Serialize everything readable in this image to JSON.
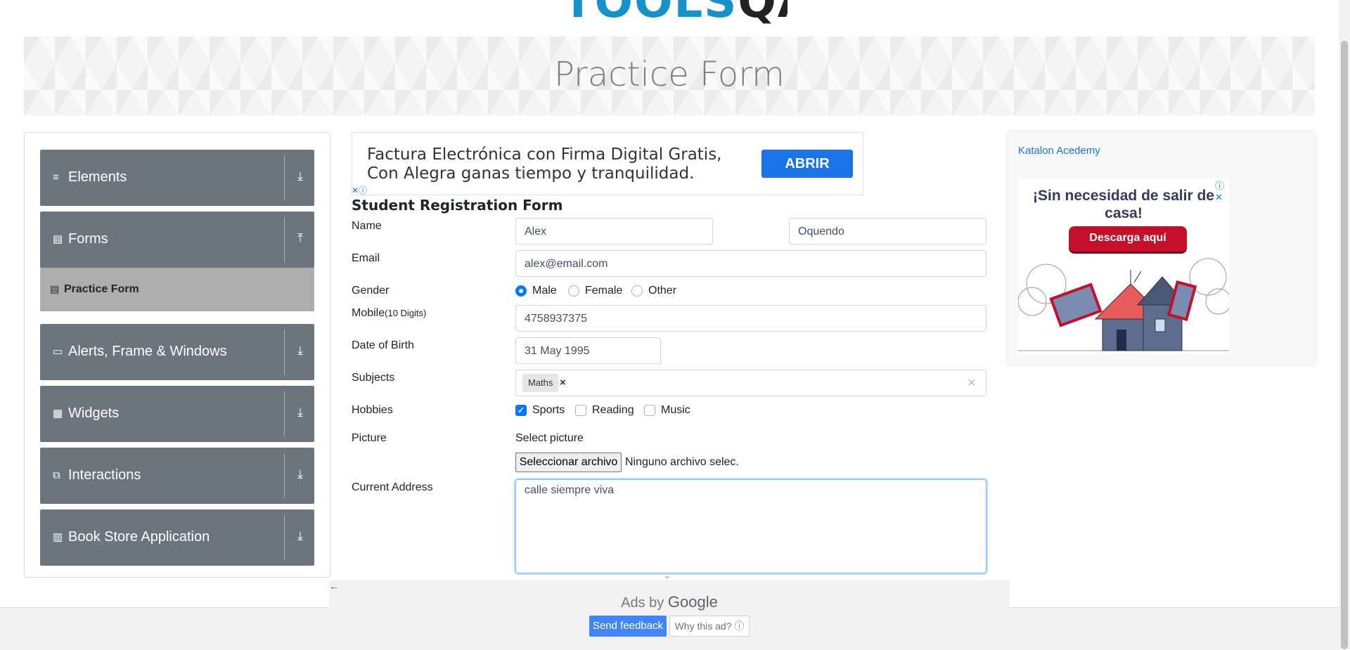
{
  "logo": {
    "text_part1": "TOOLS",
    "text_part2": "QA"
  },
  "banner": {
    "title": "Practice Form"
  },
  "sidebar": {
    "groups": [
      {
        "label": "Elements",
        "icon": "≡"
      },
      {
        "label": "Forms",
        "icon": "▤"
      },
      {
        "label": "Alerts, Frame & Windows",
        "icon": "▭"
      },
      {
        "label": "Widgets",
        "icon": "▦"
      },
      {
        "label": "Interactions",
        "icon": "⧉"
      },
      {
        "label": "Book Store Application",
        "icon": "▥"
      }
    ],
    "active_item": {
      "label": "Practice Form",
      "icon": "▤"
    }
  },
  "top_ad": {
    "line1": "Factura Electrónica con Firma Digital Gratis,",
    "line2": "Con Alegra ganas tiempo y tranquilidad.",
    "button": "ABRIR",
    "choices": "✕ⓘ"
  },
  "form": {
    "title": "Student Registration Form",
    "labels": {
      "name": "Name",
      "email": "Email",
      "gender": "Gender",
      "mobile": "Mobile",
      "mobile_hint": "(10 Digits)",
      "dob": "Date of Birth",
      "subjects": "Subjects",
      "hobbies": "Hobbies",
      "picture": "Picture",
      "address": "Current Address"
    },
    "values": {
      "first_name": "Alex",
      "last_name": "Oquendo",
      "email": "alex@email.com",
      "mobile": "4758937375",
      "dob": "31 May 1995",
      "address": "calle siempre viva"
    },
    "gender_options": [
      "Male",
      "Female",
      "Other"
    ],
    "gender_selected": "Male",
    "subjects": {
      "chip": "Maths",
      "chip_remove": "×",
      "clear": "×"
    },
    "hobbies": [
      "Sports",
      "Reading",
      "Music"
    ],
    "hobbies_checked": [
      "Sports"
    ],
    "picture": {
      "select_label": "Select picture",
      "button": "Seleccionar archivo",
      "status": "Ninguno archivo selec."
    }
  },
  "right_ad": {
    "alt_text": "Katalon Acedemy",
    "headline": "¡Sin necesidad de salir de casa!",
    "cta": "Descarga aquí",
    "close": "ⓘ ✕"
  },
  "ads_by_google": {
    "prefix": "Ads by",
    "brand": "Google",
    "send_feedback": "Send feedback",
    "why": "Why this ad? ⓘ",
    "back": "←",
    "collapse": "⌄"
  },
  "colors": {
    "sidebar_group": "#6c757d",
    "sidebar_active": "#adadad",
    "primary": "#007bff",
    "ad_button": "#1a73e8",
    "cta_red": "#c5102b"
  }
}
